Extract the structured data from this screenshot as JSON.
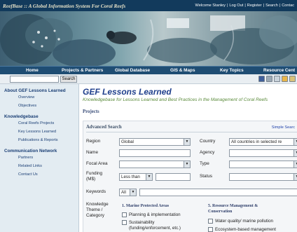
{
  "header": {
    "brand": "ReefBase  ::  A Global Information System For Coral Reefs",
    "links": [
      "Welcome Stanley",
      "Log Out",
      "Register",
      "Search",
      "Contac"
    ]
  },
  "search": {
    "button_label": "Search",
    "value": ""
  },
  "nav": [
    "Home",
    "Projects & Partners",
    "Global Database",
    "GIS & Maps",
    "Key Topics",
    "Resource Cent"
  ],
  "sidebar": {
    "sections": [
      {
        "title": "About GEF Lessons Learned",
        "items": [
          "Overview",
          "Objectives"
        ]
      },
      {
        "title": "Knowledgebase",
        "items": [
          "Coral Reefs Projects",
          "Key Lessons Learned",
          "Publications & Reports"
        ]
      },
      {
        "title": "Communication Network",
        "items": [
          "Partners",
          "Related Links",
          "Contact Us"
        ]
      }
    ]
  },
  "main": {
    "title": "GEF Lessons Learned",
    "subtitle": "Knowledgebase for Lessons Learned and Best Practices in the Management of Coral Reefs",
    "projects_link": "Projects",
    "panel_title": "Advanced Search",
    "simple_search_link": "Simple Searc",
    "fields": {
      "region_label": "Region",
      "region_value": "Global",
      "country_label": "Country",
      "country_value": "All countries in selected re",
      "name_label": "Name",
      "agency_label": "Agency",
      "focal_label": "Focal Area",
      "type_label": "Type",
      "funding_label_1": "Funding",
      "funding_label_2": "(M$)",
      "funding_op": "Less than",
      "status_label": "Status",
      "keywords_label": "Keywords",
      "keywords_op": "All"
    },
    "theme_label": [
      "Knowledge",
      "Theme /",
      "Category"
    ],
    "categories": {
      "cat1_title": "1. Marine Protected Areas",
      "cat1_items": [
        "Planning & implementation",
        "Sustainability",
        "(funding/enforcement, etc.)"
      ],
      "cat5_title_1": "5. Resource Management &",
      "cat5_title_2": "Conservation",
      "cat5_items": [
        "Water quality/ marine pollution",
        "Ecosystem-based management"
      ]
    }
  }
}
